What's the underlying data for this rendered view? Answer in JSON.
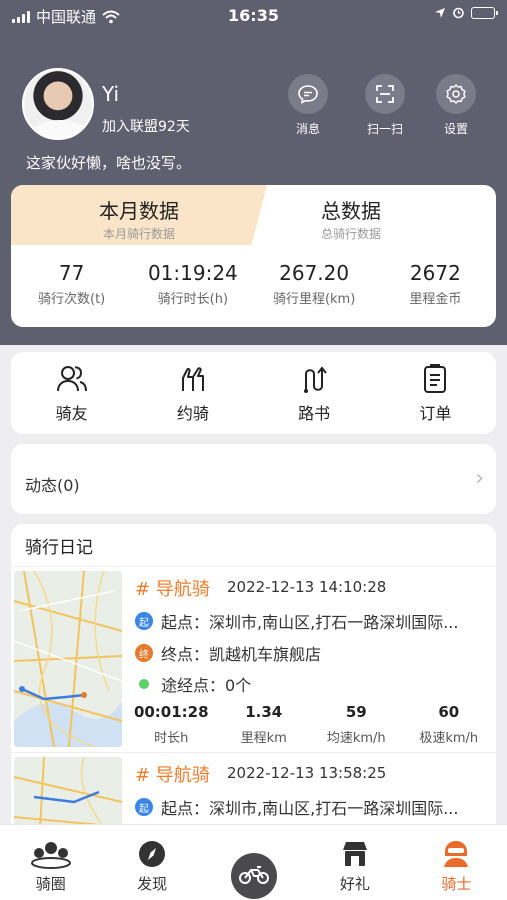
{
  "status_bar": {
    "carrier": "中国联通",
    "time": "16:35"
  },
  "profile": {
    "name": "Yi",
    "joined": "加入联盟92天",
    "bio": "这家伙好懒，啥也没写。"
  },
  "header_actions": [
    {
      "label": "消息",
      "icon": "message-icon"
    },
    {
      "label": "扫一扫",
      "icon": "scan-icon"
    },
    {
      "label": "设置",
      "icon": "gear-icon"
    }
  ],
  "data_tabs": {
    "month": {
      "title": "本月数据",
      "subtitle": "本月骑行数据"
    },
    "total": {
      "title": "总数据",
      "subtitle": "总骑行数据"
    }
  },
  "stats": [
    {
      "value": "77",
      "label": "骑行次数(t)"
    },
    {
      "value": "01:19:24",
      "label": "骑行时长(h)"
    },
    {
      "value": "267.20",
      "label": "骑行里程(km)"
    },
    {
      "value": "2672",
      "label": "里程金币"
    }
  ],
  "quick_menu": [
    {
      "label": "骑友",
      "icon": "friends-icon"
    },
    {
      "label": "约骑",
      "icon": "handshake-icon"
    },
    {
      "label": "路书",
      "icon": "route-icon"
    },
    {
      "label": "订单",
      "icon": "order-icon"
    }
  ],
  "dynamic": {
    "label": "动态(0)"
  },
  "diary": {
    "title": "骑行日记",
    "entries": [
      {
        "tag": "# 导航骑",
        "datetime": "2022-12-13 14:10:28",
        "start_badge": "起",
        "start_label": "起点：",
        "start": "深圳市,南山区,打石一路深圳国际...",
        "end_badge": "终",
        "end_label": "终点：",
        "end": "凯越机车旗舰店",
        "via_label": "途经点：",
        "via": "0个",
        "metrics": [
          {
            "value": "00:01:28",
            "label": "时长h"
          },
          {
            "value": "1.34",
            "label": "里程km"
          },
          {
            "value": "59",
            "label": "均速km/h"
          },
          {
            "value": "60",
            "label": "极速km/h"
          }
        ]
      },
      {
        "tag": "# 导航骑",
        "datetime": "2022-12-13 13:58:25",
        "start_badge": "起",
        "start_label": "起点：",
        "start": "深圳市,南山区,打石一路深圳国际..."
      }
    ]
  },
  "tabbar": [
    {
      "label": "骑圈",
      "icon": "riders-circle-icon"
    },
    {
      "label": "发现",
      "icon": "compass-icon"
    },
    {
      "label": "",
      "icon": "motorcycle-icon"
    },
    {
      "label": "好礼",
      "icon": "gift-shop-icon"
    },
    {
      "label": "骑士",
      "icon": "rider-helmet-icon"
    }
  ],
  "colors": {
    "header_bg": "#5e5f6f",
    "accent_orange": "#e86b2a",
    "month_tab_bg": "#fbe5c8",
    "start_badge": "#3a86e8",
    "end_badge": "#e8782a",
    "via_dot": "#5ad36b"
  }
}
